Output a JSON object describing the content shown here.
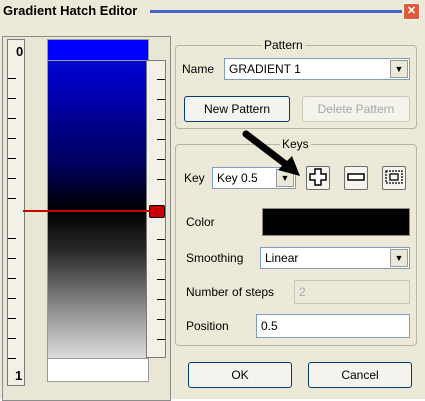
{
  "window": {
    "title": "Gradient Hatch Editor",
    "close_glyph": "✕"
  },
  "ruler": {
    "top_label": "0",
    "bottom_label": "1"
  },
  "pattern_group": {
    "title": "Pattern",
    "name_label": "Name",
    "name_value": "GRADIENT 1",
    "new_button": "New Pattern",
    "delete_button": "Delete Pattern"
  },
  "keys_group": {
    "title": "Keys",
    "key_label": "Key",
    "key_value": "Key 0.5",
    "add_icon": "plus-icon",
    "remove_icon": "minus-icon",
    "duplicate_icon": "copy-key-icon",
    "color_label": "Color",
    "color_value": "#000000",
    "smoothing_label": "Smoothing",
    "smoothing_value": "Linear",
    "steps_label": "Number of steps",
    "steps_value": "2",
    "position_label": "Position",
    "position_value": "0.5"
  },
  "buttons": {
    "ok": "OK",
    "cancel": "Cancel"
  },
  "colors": {
    "gradient_top": "#0000ff",
    "gradient_mid": "#000000",
    "gradient_bottom": "#ffffff",
    "key_marker": "#cc0000"
  }
}
